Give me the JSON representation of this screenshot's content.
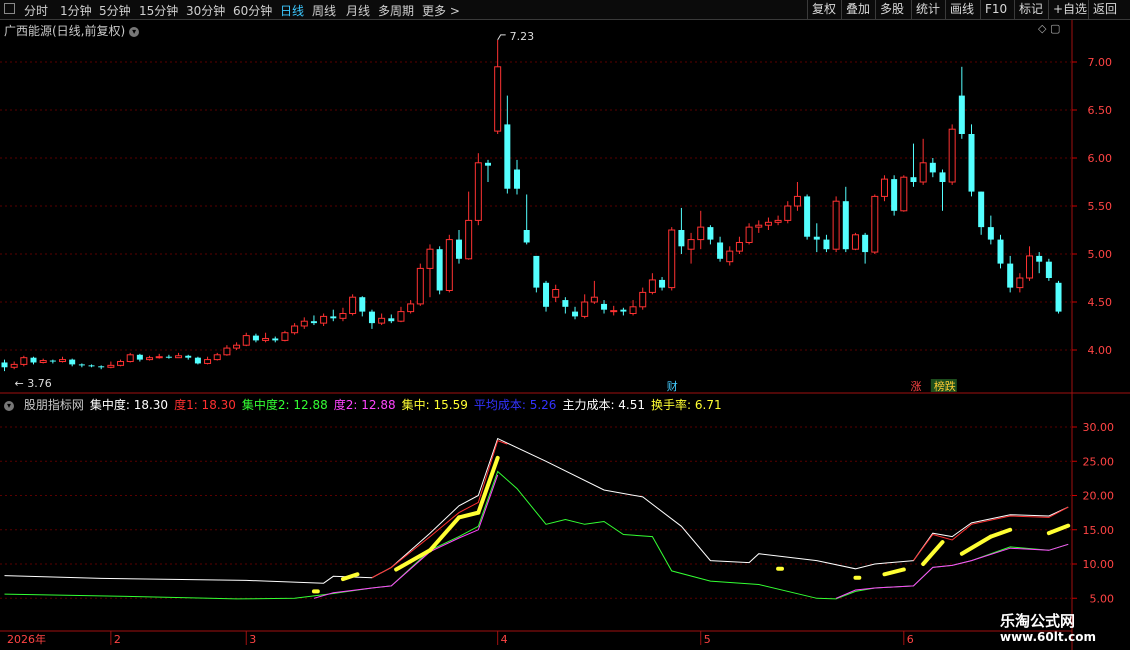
{
  "toolbar": {
    "periods": [
      "分时",
      "1分钟",
      "5分钟",
      "15分钟",
      "30分钟",
      "60分钟",
      "日线",
      "周线",
      "月线",
      "多周期",
      "更多 >"
    ],
    "active_period": "日线",
    "tools": [
      "复权",
      "叠加",
      "多股",
      "统计",
      "画线",
      "F10",
      "标记",
      "+自选",
      "返回"
    ]
  },
  "main_title": "广西能源(日线,前复权)",
  "indicator": {
    "name": "股朋指标网",
    "labels": [
      {
        "text": "集中度: 18.30",
        "color": "#ffffff"
      },
      {
        "text": "度1: 18.30",
        "color": "#ff3030"
      },
      {
        "text": "集中度2: 12.88",
        "color": "#33ff33"
      },
      {
        "text": "度2: 12.88",
        "color": "#ff44ff"
      },
      {
        "text": "集中: 15.59",
        "color": "#ffff33"
      },
      {
        "text": "平均成本: 5.26",
        "color": "#3333ff"
      },
      {
        "text": "主力成本: 4.51",
        "color": "#ffffff"
      },
      {
        "text": "换手率: 6.71",
        "color": "#ffff33"
      }
    ]
  },
  "markers": {
    "fin": "财",
    "zhang": "涨",
    "list": "榜跌"
  },
  "watermark": {
    "name": "乐淘公式网",
    "url": "www.60lt.com"
  },
  "colors": {
    "up": "#ff3232",
    "down": "#54ffff",
    "grid": "#5a0000",
    "axis": "#c8c8c8"
  },
  "chart_data": [
    {
      "type": "candlestick",
      "y_ticks": [
        7.0,
        6.5,
        6.0,
        5.5,
        5.0,
        4.5,
        4.0
      ],
      "ylim": [
        3.6,
        7.5
      ],
      "annotations": {
        "high": "7.23",
        "low": "3.76"
      },
      "candles": [
        [
          3.87,
          3.82,
          3.9,
          3.78
        ],
        [
          3.82,
          3.85,
          3.88,
          3.8
        ],
        [
          3.85,
          3.92,
          3.94,
          3.83
        ],
        [
          3.92,
          3.87,
          3.93,
          3.85
        ],
        [
          3.87,
          3.89,
          3.91,
          3.86
        ],
        [
          3.89,
          3.88,
          3.9,
          3.86
        ],
        [
          3.88,
          3.9,
          3.93,
          3.87
        ],
        [
          3.9,
          3.85,
          3.91,
          3.83
        ],
        [
          3.85,
          3.84,
          3.86,
          3.82
        ],
        [
          3.84,
          3.83,
          3.85,
          3.82
        ],
        [
          3.83,
          3.82,
          3.84,
          3.8
        ],
        [
          3.82,
          3.84,
          3.88,
          3.81
        ],
        [
          3.84,
          3.88,
          3.9,
          3.83
        ],
        [
          3.88,
          3.95,
          3.97,
          3.87
        ],
        [
          3.95,
          3.9,
          3.96,
          3.88
        ],
        [
          3.9,
          3.92,
          3.94,
          3.89
        ],
        [
          3.92,
          3.93,
          3.96,
          3.91
        ],
        [
          3.93,
          3.92,
          3.95,
          3.91
        ],
        [
          3.92,
          3.94,
          3.97,
          3.92
        ],
        [
          3.94,
          3.92,
          3.95,
          3.9
        ],
        [
          3.92,
          3.86,
          3.93,
          3.85
        ],
        [
          3.86,
          3.9,
          3.93,
          3.85
        ],
        [
          3.9,
          3.95,
          3.97,
          3.89
        ],
        [
          3.95,
          4.02,
          4.05,
          3.94
        ],
        [
          4.02,
          4.05,
          4.08,
          4.0
        ],
        [
          4.05,
          4.15,
          4.18,
          4.04
        ],
        [
          4.15,
          4.1,
          4.17,
          4.08
        ],
        [
          4.1,
          4.12,
          4.18,
          4.08
        ],
        [
          4.12,
          4.1,
          4.14,
          4.08
        ],
        [
          4.1,
          4.18,
          4.2,
          4.09
        ],
        [
          4.18,
          4.25,
          4.28,
          4.16
        ],
        [
          4.25,
          4.3,
          4.34,
          4.22
        ],
        [
          4.3,
          4.28,
          4.36,
          4.26
        ],
        [
          4.28,
          4.35,
          4.38,
          4.25
        ],
        [
          4.35,
          4.33,
          4.42,
          4.3
        ],
        [
          4.33,
          4.38,
          4.44,
          4.3
        ],
        [
          4.38,
          4.55,
          4.58,
          4.36
        ],
        [
          4.55,
          4.4,
          4.56,
          4.35
        ],
        [
          4.4,
          4.28,
          4.42,
          4.22
        ],
        [
          4.28,
          4.33,
          4.38,
          4.26
        ],
        [
          4.33,
          4.3,
          4.37,
          4.28
        ],
        [
          4.3,
          4.4,
          4.45,
          4.29
        ],
        [
          4.4,
          4.48,
          4.52,
          4.38
        ],
        [
          4.48,
          4.85,
          4.9,
          4.46
        ],
        [
          4.85,
          5.05,
          5.1,
          4.55
        ],
        [
          5.05,
          4.62,
          5.08,
          4.58
        ],
        [
          4.62,
          5.15,
          5.2,
          4.6
        ],
        [
          5.15,
          4.95,
          5.25,
          4.9
        ],
        [
          4.95,
          5.35,
          5.65,
          4.94
        ],
        [
          5.35,
          5.95,
          6.05,
          5.3
        ],
        [
          5.95,
          5.92,
          5.98,
          5.75
        ],
        [
          6.28,
          6.95,
          7.23,
          6.25
        ],
        [
          6.35,
          5.68,
          6.65,
          5.63
        ],
        [
          5.88,
          5.68,
          5.98,
          5.62
        ],
        [
          5.25,
          5.12,
          5.62,
          5.1
        ],
        [
          4.98,
          4.65,
          4.98,
          4.6
        ],
        [
          4.7,
          4.45,
          4.72,
          4.4
        ],
        [
          4.55,
          4.63,
          4.68,
          4.5
        ],
        [
          4.52,
          4.45,
          4.55,
          4.38
        ],
        [
          4.4,
          4.35,
          4.45,
          4.32
        ],
        [
          4.35,
          4.5,
          4.58,
          4.33
        ],
        [
          4.5,
          4.55,
          4.72,
          4.48
        ],
        [
          4.48,
          4.42,
          4.52,
          4.38
        ],
        [
          4.4,
          4.41,
          4.46,
          4.36
        ],
        [
          4.42,
          4.4,
          4.44,
          4.36
        ],
        [
          4.38,
          4.45,
          4.52,
          4.36
        ],
        [
          4.45,
          4.6,
          4.65,
          4.42
        ],
        [
          4.6,
          4.73,
          4.8,
          4.58
        ],
        [
          4.73,
          4.65,
          4.76,
          4.62
        ],
        [
          4.65,
          5.25,
          5.28,
          4.62
        ],
        [
          5.25,
          5.08,
          5.48,
          5.0
        ],
        [
          5.05,
          5.15,
          5.22,
          4.9
        ],
        [
          5.15,
          5.28,
          5.45,
          5.05
        ],
        [
          5.28,
          5.15,
          5.3,
          5.1
        ],
        [
          5.12,
          4.95,
          5.18,
          4.92
        ],
        [
          4.92,
          5.03,
          5.08,
          4.88
        ],
        [
          5.03,
          5.12,
          5.18,
          5.0
        ],
        [
          5.12,
          5.28,
          5.32,
          5.1
        ],
        [
          5.28,
          5.3,
          5.35,
          5.22
        ],
        [
          5.3,
          5.33,
          5.38,
          5.25
        ],
        [
          5.33,
          5.35,
          5.4,
          5.3
        ],
        [
          5.35,
          5.5,
          5.55,
          5.32
        ],
        [
          5.5,
          5.6,
          5.75,
          5.45
        ],
        [
          5.6,
          5.18,
          5.62,
          5.15
        ],
        [
          5.18,
          5.15,
          5.32,
          5.02
        ],
        [
          5.15,
          5.05,
          5.2,
          5.02
        ],
        [
          5.05,
          5.55,
          5.6,
          5.02
        ],
        [
          5.55,
          5.05,
          5.7,
          5.02
        ],
        [
          5.05,
          5.2,
          5.22,
          5.04
        ],
        [
          5.2,
          5.02,
          5.22,
          4.9
        ],
        [
          5.02,
          5.6,
          5.62,
          5.0
        ],
        [
          5.6,
          5.78,
          5.82,
          5.55
        ],
        [
          5.78,
          5.45,
          5.82,
          5.4
        ],
        [
          5.45,
          5.8,
          5.82,
          5.44
        ],
        [
          5.8,
          5.75,
          6.15,
          5.7
        ],
        [
          5.75,
          5.95,
          6.2,
          5.72
        ],
        [
          5.95,
          5.85,
          6.0,
          5.8
        ],
        [
          5.85,
          5.75,
          5.88,
          5.45
        ],
        [
          5.75,
          6.3,
          6.35,
          5.72
        ],
        [
          6.65,
          6.25,
          6.95,
          6.2
        ],
        [
          6.25,
          5.65,
          6.35,
          5.6
        ],
        [
          5.65,
          5.28,
          5.65,
          5.2
        ],
        [
          5.28,
          5.15,
          5.4,
          5.1
        ],
        [
          5.15,
          4.9,
          5.2,
          4.85
        ],
        [
          4.9,
          4.65,
          4.98,
          4.6
        ],
        [
          4.65,
          4.75,
          4.8,
          4.6
        ],
        [
          4.75,
          4.98,
          5.08,
          4.72
        ],
        [
          4.98,
          4.92,
          5.02,
          4.8
        ],
        [
          4.92,
          4.75,
          4.95,
          4.72
        ],
        [
          4.7,
          4.4,
          4.72,
          4.38
        ]
      ]
    },
    {
      "type": "line",
      "y_ticks": [
        30.0,
        25.0,
        20.0,
        15.0,
        10.0,
        5.0
      ],
      "ylim": [
        4.5,
        33.5
      ],
      "x_ticks": [
        {
          "label": "2026年",
          "index": 0
        },
        {
          "label": "2",
          "index": 11
        },
        {
          "label": "3",
          "index": 25
        },
        {
          "label": "4",
          "index": 51
        },
        {
          "label": "5",
          "index": 72
        },
        {
          "label": "6",
          "index": 93
        }
      ],
      "series": [
        {
          "name": "集中度",
          "color": "#ffffff",
          "points": [
            [
              0,
              8.3
            ],
            [
              10,
              7.9
            ],
            [
              25,
              7.6
            ],
            [
              33,
              7.2
            ],
            [
              34,
              8.2
            ],
            [
              38,
              8.0
            ],
            [
              40,
              9.5
            ],
            [
              44,
              14.5
            ],
            [
              47,
              18.5
            ],
            [
              49,
              20.0
            ],
            [
              51,
              28.3
            ],
            [
              56,
              25.0
            ],
            [
              62,
              20.8
            ],
            [
              66,
              19.8
            ],
            [
              70,
              15.5
            ],
            [
              73,
              10.5
            ],
            [
              77,
              10.2
            ],
            [
              78,
              11.5
            ],
            [
              84,
              10.5
            ],
            [
              88,
              9.3
            ],
            [
              90,
              10.0
            ],
            [
              94,
              10.5
            ],
            [
              96,
              14.5
            ],
            [
              98,
              14.0
            ],
            [
              100,
              16.0
            ],
            [
              104,
              17.2
            ],
            [
              108,
              17.0
            ],
            [
              110,
              18.3
            ]
          ]
        },
        {
          "name": "度1",
          "color": "#ff3030",
          "points": [
            [
              38,
              8.0
            ],
            [
              40,
              9.5
            ],
            [
              44,
              14.0
            ],
            [
              47,
              17.5
            ],
            [
              49,
              19.0
            ],
            [
              51,
              28.0
            ],
            [
              52,
              27.5
            ]
          ]
        },
        {
          "name": "度1b",
          "color": "#ff3030",
          "points": [
            [
              94,
              10.5
            ],
            [
              96,
              14.3
            ],
            [
              98,
              13.5
            ],
            [
              100,
              15.8
            ],
            [
              104,
              17.0
            ],
            [
              108,
              16.8
            ],
            [
              110,
              18.3
            ]
          ]
        },
        {
          "name": "集中度2",
          "color": "#33ff33",
          "points": [
            [
              0,
              5.6
            ],
            [
              12,
              5.3
            ],
            [
              24,
              4.9
            ],
            [
              30,
              5.0
            ],
            [
              34,
              5.7
            ],
            [
              38,
              6.5
            ],
            [
              40,
              6.8
            ],
            [
              44,
              12.0
            ],
            [
              47,
              14.0
            ],
            [
              49,
              15.5
            ],
            [
              51,
              23.5
            ],
            [
              53,
              21.0
            ],
            [
              56,
              15.8
            ],
            [
              58,
              16.5
            ],
            [
              60,
              15.8
            ],
            [
              62,
              16.2
            ],
            [
              64,
              14.3
            ],
            [
              67,
              14.0
            ],
            [
              69,
              9.0
            ],
            [
              73,
              7.5
            ],
            [
              78,
              7.0
            ],
            [
              84,
              5.0
            ],
            [
              86,
              4.9
            ],
            [
              88,
              6.0
            ],
            [
              90,
              6.5
            ],
            [
              94,
              6.8
            ],
            [
              96,
              9.5
            ],
            [
              98,
              9.8
            ],
            [
              100,
              10.5
            ],
            [
              104,
              12.5
            ],
            [
              108,
              12.0
            ],
            [
              110,
              12.88
            ]
          ]
        },
        {
          "name": "度2",
          "color": "#ff44ff",
          "points": [
            [
              32,
              5.0
            ],
            [
              34,
              5.8
            ],
            [
              38,
              6.5
            ],
            [
              40,
              6.8
            ],
            [
              44,
              11.8
            ],
            [
              47,
              13.8
            ],
            [
              49,
              15.0
            ],
            [
              51,
              23.0
            ]
          ]
        },
        {
          "name": "度2b",
          "color": "#ff44ff",
          "points": [
            [
              86,
              5.0
            ],
            [
              88,
              6.2
            ],
            [
              90,
              6.5
            ],
            [
              94,
              6.8
            ],
            [
              96,
              9.5
            ],
            [
              98,
              9.8
            ],
            [
              100,
              10.5
            ],
            [
              104,
              12.3
            ],
            [
              108,
              12.0
            ],
            [
              110,
              12.88
            ]
          ]
        }
      ],
      "highlights": [
        [
          [
            32,
            6.0
          ],
          [
            32.4,
            6.0
          ]
        ],
        [
          [
            35,
            7.8
          ],
          [
            36.5,
            8.5
          ]
        ],
        [
          [
            40.5,
            9.2
          ],
          [
            44,
            12.0
          ]
        ],
        [
          [
            44,
            12.0
          ],
          [
            47,
            16.8
          ]
        ],
        [
          [
            47,
            16.8
          ],
          [
            49,
            17.5
          ]
        ],
        [
          [
            49,
            17.5
          ],
          [
            51,
            25.5
          ]
        ],
        [
          [
            80,
            9.3
          ],
          [
            80.4,
            9.3
          ]
        ],
        [
          [
            88,
            8.0
          ],
          [
            88.4,
            8.0
          ]
        ],
        [
          [
            91,
            8.5
          ],
          [
            93,
            9.2
          ]
        ],
        [
          [
            95,
            10.0
          ],
          [
            97,
            13.2
          ]
        ],
        [
          [
            99,
            11.5
          ],
          [
            102,
            14.0
          ]
        ],
        [
          [
            102,
            14.0
          ],
          [
            104,
            15.0
          ]
        ],
        [
          [
            108,
            14.5
          ],
          [
            110,
            15.6
          ]
        ]
      ]
    }
  ]
}
